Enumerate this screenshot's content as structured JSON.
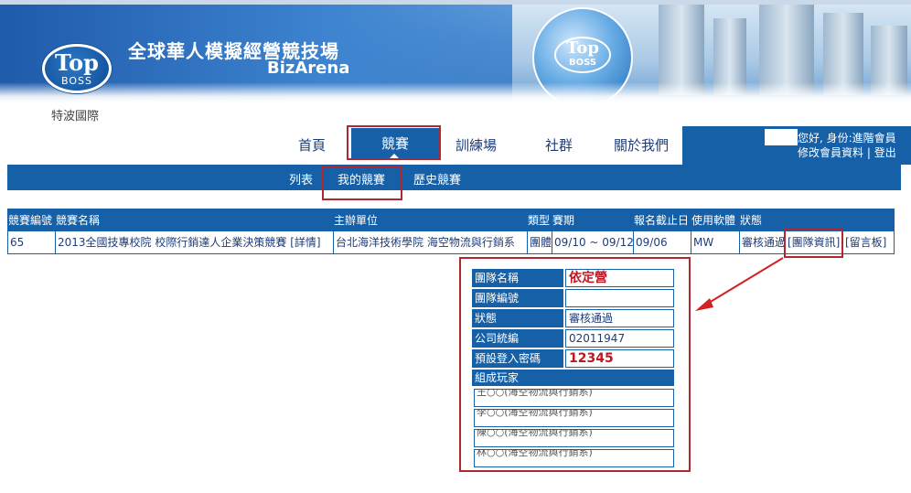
{
  "banner": {
    "title": "全球華人模擬經營競技場",
    "subtitle": "BizArena",
    "logo_top": "Top",
    "logo_boss": "BOSS",
    "company": "特波國際"
  },
  "nav": {
    "items": [
      "首頁",
      "競賽",
      "訓練場",
      "社群",
      "關於我們"
    ],
    "active": "競賽"
  },
  "user": {
    "greeting": "您好, 身份:進階會員",
    "edit_profile": "修改會員資料",
    "separator": "|",
    "logout": "登出"
  },
  "subnav": {
    "items": [
      "列表",
      "我的競賽",
      "歷史競賽"
    ],
    "active": "我的競賽"
  },
  "table": {
    "headers": [
      "競賽編號",
      "競賽名稱",
      "主辦單位",
      "類型",
      "賽期",
      "報名截止日",
      "使用軟體",
      "狀態"
    ],
    "rows": [
      {
        "id": "65",
        "name": "2013全國技專校院 校際行銷達人企業決策競賽",
        "detail_link": "[詳情]",
        "organizer": "台北海洋技術學院 海空物流與行銷系",
        "type": "團體",
        "period": "09/10 ~ 09/12",
        "deadline": "09/06",
        "software": "MW",
        "status": "審核通過",
        "team_link": "[團隊資訊]",
        "board_link": "[留言板]"
      }
    ]
  },
  "team_info": {
    "rows": [
      {
        "label": "團隊名稱",
        "value": "依定營"
      },
      {
        "label": "團隊編號",
        "value": ""
      },
      {
        "label": "狀態",
        "value": "審核通過"
      },
      {
        "label": "公司統編",
        "value": "02011947"
      },
      {
        "label": "預設登入密碼",
        "value": "12345"
      }
    ],
    "members_label": "組成玩家",
    "members": [
      "王○○(海空物流與行銷系)",
      "李○○(海空物流與行銷系)",
      "陳○○(海空物流與行銷系)",
      "林○○(海空物流與行銷系)"
    ]
  },
  "colors": {
    "primary": "#1660a8",
    "highlight": "#b3262d",
    "password_red": "#c0181f"
  }
}
